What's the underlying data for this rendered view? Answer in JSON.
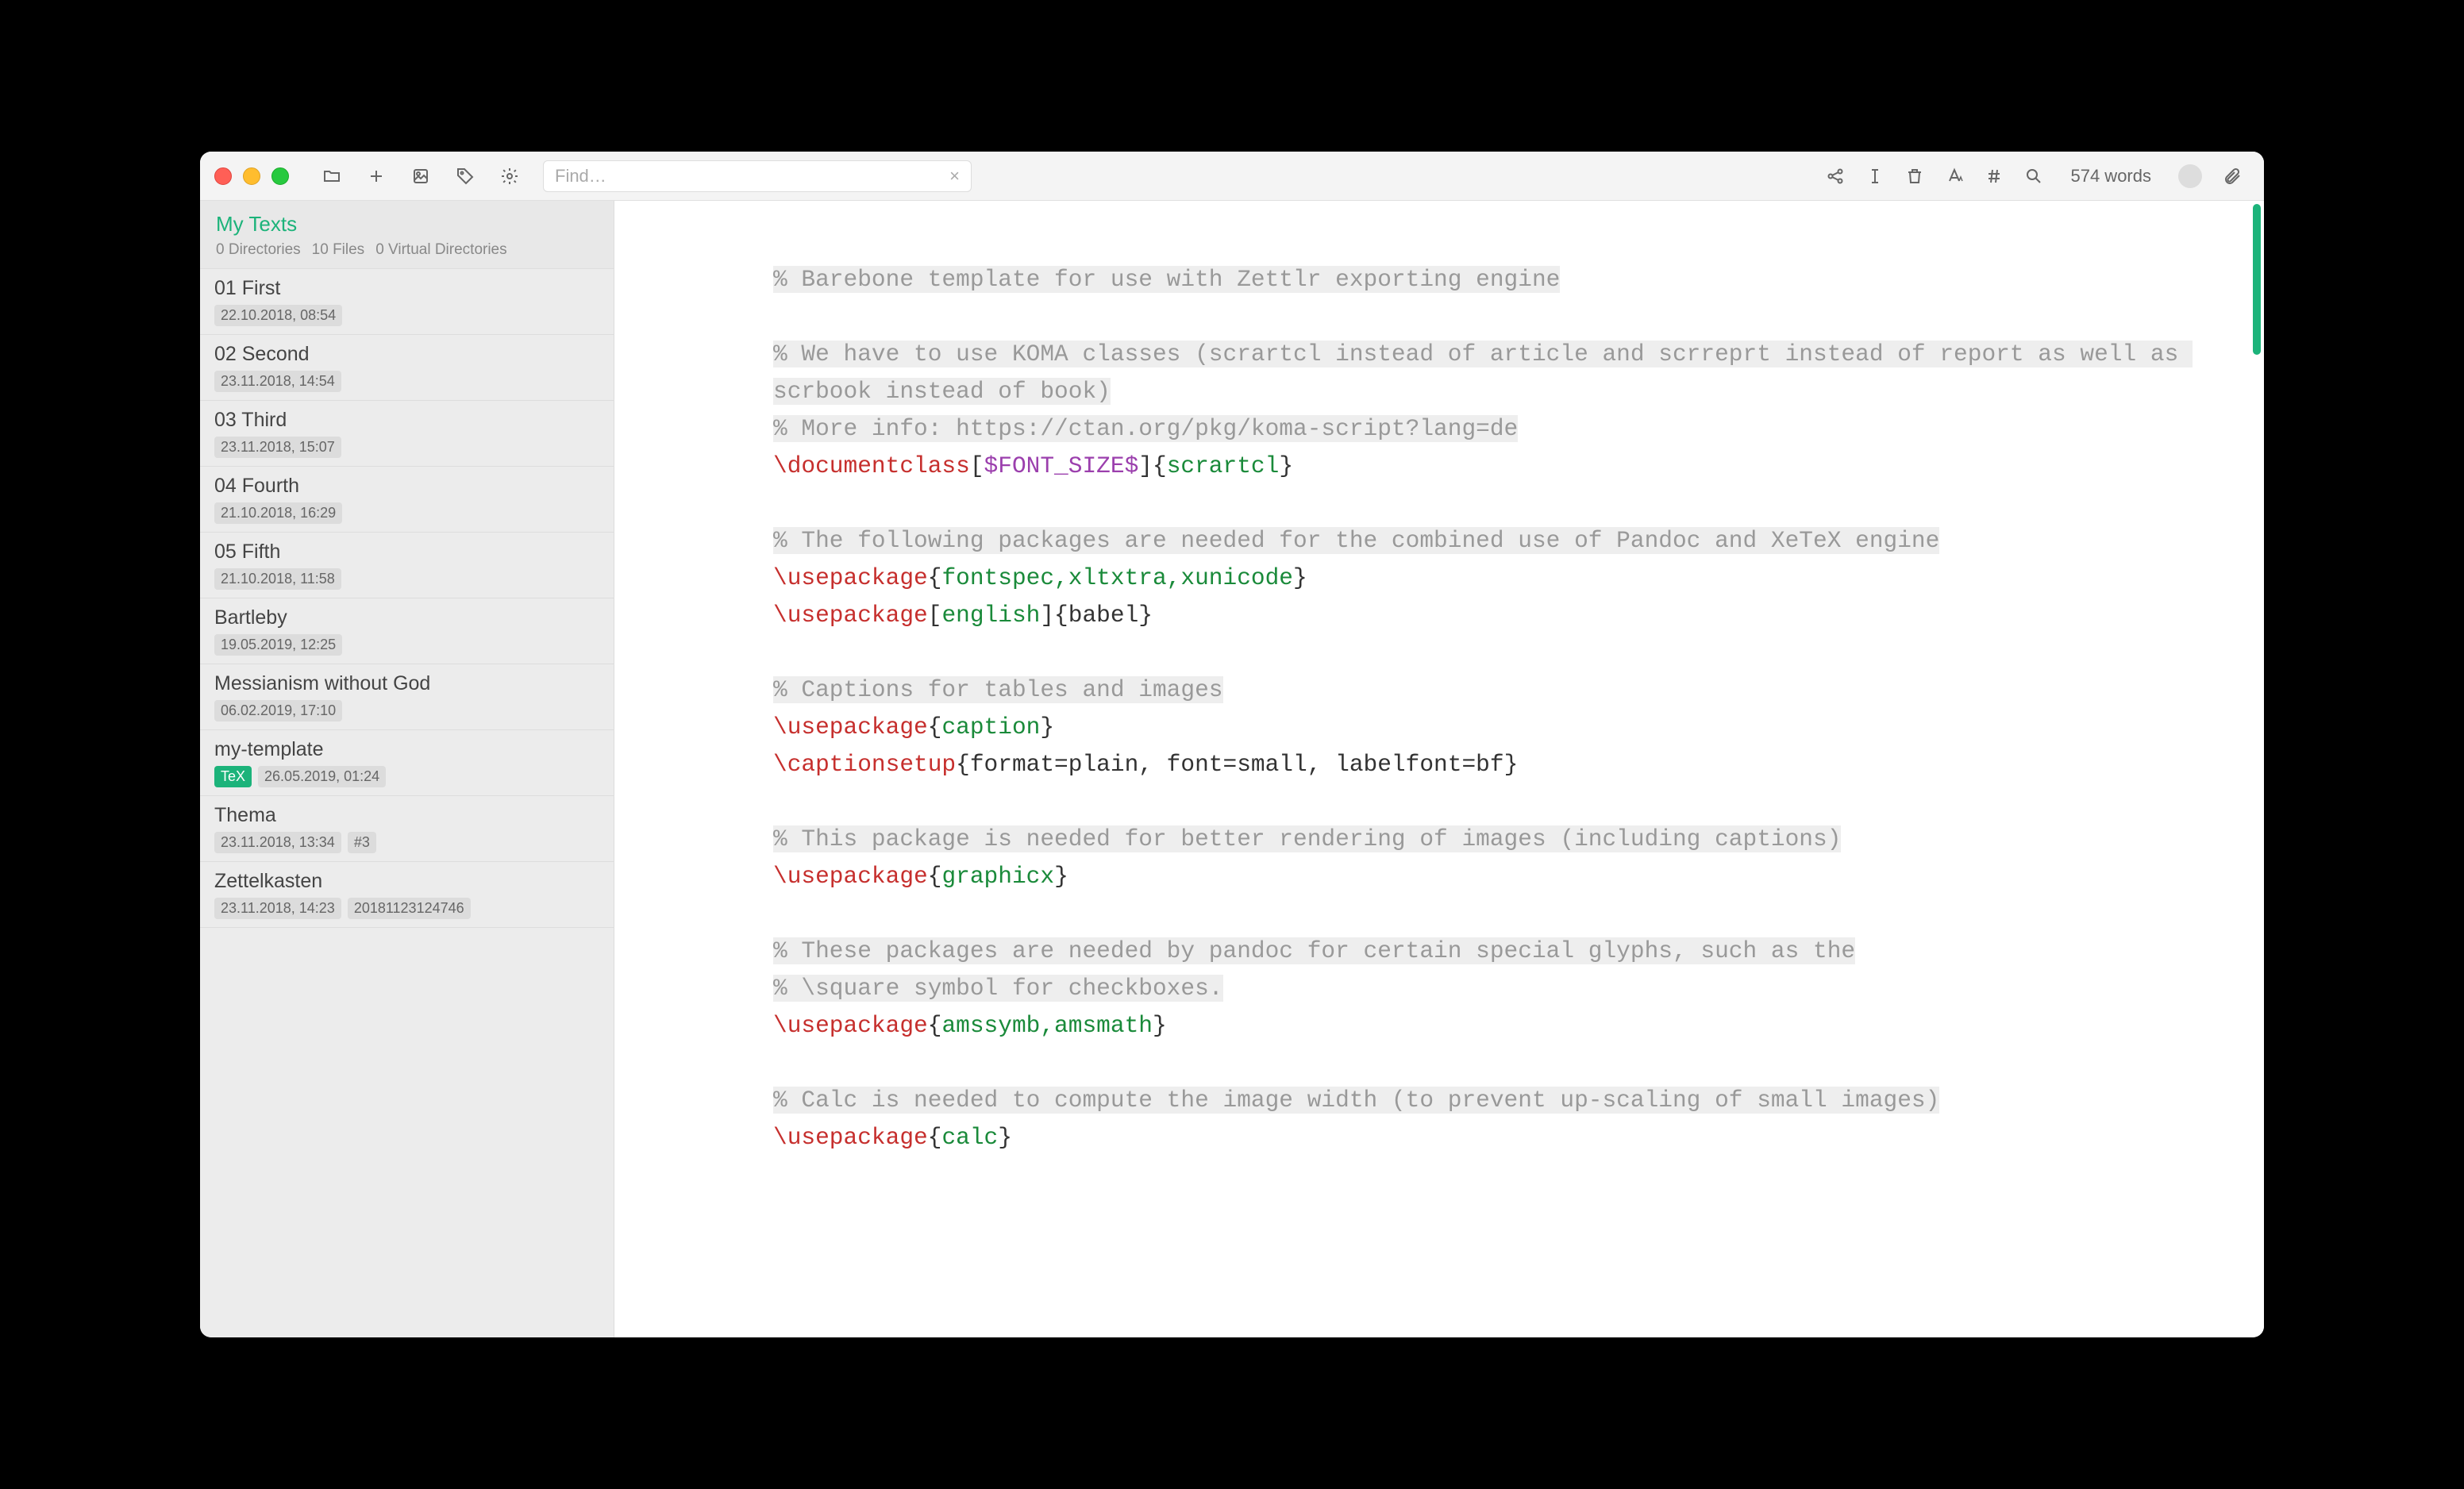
{
  "search": {
    "placeholder": "Find…"
  },
  "wordcount": "574 words",
  "sidebar": {
    "title": "My Texts",
    "dirs": "0 Directories",
    "files": "10 Files",
    "vdirs": "0 Virtual Directories"
  },
  "files": [
    {
      "title": "01 First",
      "date": "22.10.2018, 08:54"
    },
    {
      "title": "02 Second",
      "date": "23.11.2018, 14:54"
    },
    {
      "title": "03 Third",
      "date": "23.11.2018, 15:07"
    },
    {
      "title": "04 Fourth",
      "date": "21.10.2018, 16:29"
    },
    {
      "title": "05 Fifth",
      "date": "21.10.2018, 11:58"
    },
    {
      "title": "Bartleby",
      "date": "19.05.2019, 12:25"
    },
    {
      "title": "Messianism without God",
      "date": "06.02.2019, 17:10"
    },
    {
      "title": "my-template",
      "date": "26.05.2019, 01:24",
      "badge": "TeX"
    },
    {
      "title": "Thema",
      "date": "23.11.2018, 13:34",
      "extra": "#3"
    },
    {
      "title": "Zettelkasten",
      "date": "23.11.2018, 14:23",
      "extra": "20181123124746"
    }
  ],
  "code": {
    "c1": "% Barebone template for use with Zettlr exporting engine",
    "c2": "% We have to use KOMA classes (scrartcl instead of article and scrreprt instead of report as well as scrbook instead of book)",
    "c3": "% More info: https://ctan.org/pkg/koma-script?lang=de",
    "documentclass": "\\documentclass",
    "fontsize": "$FONT_SIZE$",
    "scrartcl": "scrartcl",
    "c4": "% The following packages are needed for the combined use of Pandoc and XeTeX engine",
    "usepackage": "\\usepackage",
    "fontspec": "fontspec,xltxtra,xunicode",
    "english": "english",
    "babel": "babel",
    "c5": "% Captions for tables and images",
    "caption": "caption",
    "captionsetup": "\\captionsetup",
    "captargs": "format=plain, font=small, labelfont=bf",
    "c6": "% This package is needed for better rendering of images (including captions)",
    "graphicx": "graphicx",
    "c7a": "% These packages are needed by pandoc for certain special glyphs, such as the",
    "c7b": "% \\square symbol for checkboxes.",
    "amssymb": "amssymb,amsmath",
    "c8": "% Calc is needed to compute the image width (to prevent up-scaling of small images)",
    "calc": "calc"
  }
}
